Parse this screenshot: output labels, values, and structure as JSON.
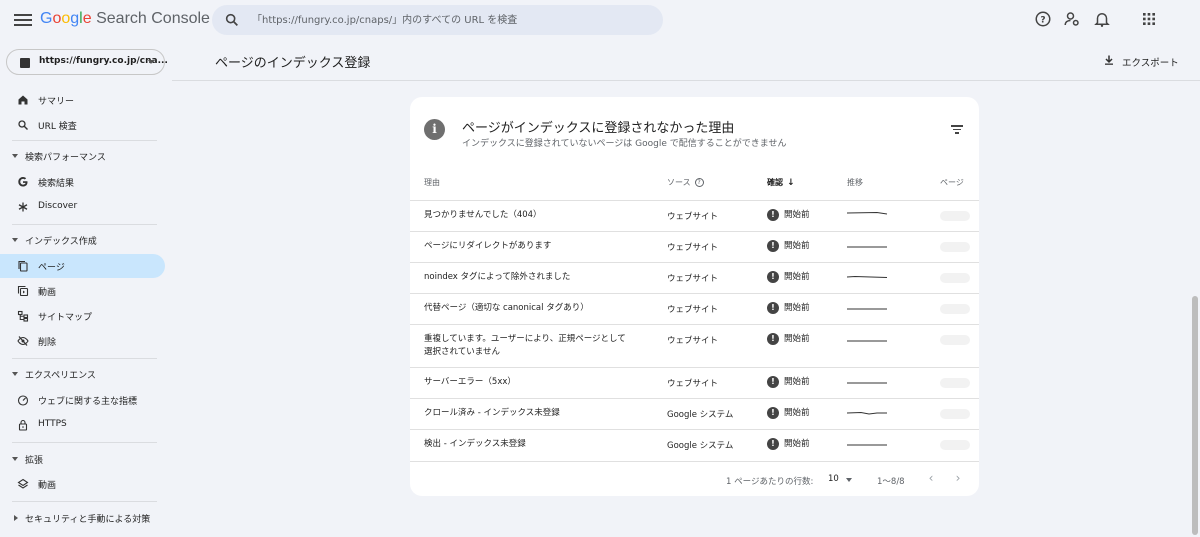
{
  "app": {
    "logo_google": [
      "G",
      "o",
      "o",
      "g",
      "l",
      "e"
    ],
    "logo_product": "Search Console"
  },
  "search": {
    "placeholder": "「https://fungry.co.jp/cnaps/」内のすべての URL を検査"
  },
  "property": {
    "label": "https://fungry.co.jp/cna..."
  },
  "sidebar": {
    "items": [
      {
        "label": "サマリー",
        "icon": "home-icon"
      },
      {
        "label": "URL 検査",
        "icon": "search-icon"
      }
    ],
    "sections": [
      {
        "label": "検索パフォーマンス",
        "items": [
          {
            "label": "検索結果",
            "icon": "google-g-icon"
          },
          {
            "label": "Discover",
            "icon": "asterisk-icon"
          }
        ]
      },
      {
        "label": "インデックス作成",
        "items": [
          {
            "label": "ページ",
            "icon": "pages-icon",
            "active": true
          },
          {
            "label": "動画",
            "icon": "video-icon"
          },
          {
            "label": "サイトマップ",
            "icon": "sitemap-icon"
          },
          {
            "label": "削除",
            "icon": "removal-icon"
          }
        ]
      },
      {
        "label": "エクスペリエンス",
        "items": [
          {
            "label": "ウェブに関する主な指標",
            "icon": "gauge-icon"
          },
          {
            "label": "HTTPS",
            "icon": "lock-icon"
          }
        ]
      },
      {
        "label": "拡張",
        "items": [
          {
            "label": "動画",
            "icon": "layers-icon"
          }
        ]
      },
      {
        "label": "セキュリティと手動による対策",
        "items": []
      }
    ]
  },
  "header": {
    "title": "ページのインデックス登録",
    "export_label": "エクスポート"
  },
  "card": {
    "title": "ページがインデックスに登録されなかった理由",
    "subtitle": "インデックスに登録されていないページは Google で配信することができません",
    "columns": {
      "reason": "理由",
      "source": "ソース",
      "status": "確認",
      "trend": "推移",
      "pages": "ページ"
    },
    "status_icon": "!",
    "rows": [
      {
        "reason": "見つかりませんでした（404）",
        "source": "ウェブサイト",
        "status": "開始前"
      },
      {
        "reason": "ページにリダイレクトがあります",
        "source": "ウェブサイト",
        "status": "開始前"
      },
      {
        "reason": "noindex タグによって除外されました",
        "source": "ウェブサイト",
        "status": "開始前"
      },
      {
        "reason": "代替ページ（適切な canonical タグあり）",
        "source": "ウェブサイト",
        "status": "開始前"
      },
      {
        "reason": "重複しています。ユーザーにより、正規ページとして選択されていません",
        "source": "ウェブサイト",
        "status": "開始前"
      },
      {
        "reason": "サーバーエラー（5xx）",
        "source": "ウェブサイト",
        "status": "開始前"
      },
      {
        "reason": "クロール済み - インデックス未登録",
        "source": "Google システム",
        "status": "開始前"
      },
      {
        "reason": "検出 - インデックス未登録",
        "source": "Google システム",
        "status": "開始前"
      }
    ],
    "pagination": {
      "rows_per_page_label": "1 ページあたりの行数:",
      "rows_per_page": "10",
      "range": "1～8/8"
    }
  },
  "colors": {
    "active_nav": "#c9e6fd",
    "background": "#f1f3f8",
    "card": "#ffffff"
  }
}
